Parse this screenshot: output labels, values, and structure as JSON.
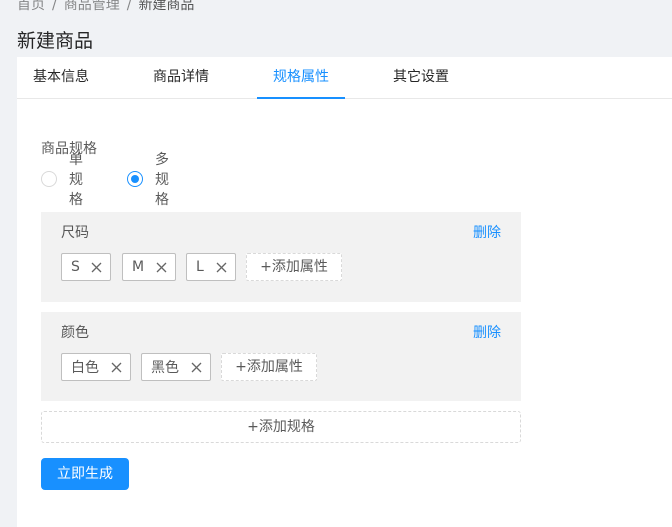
{
  "breadcrumb": {
    "items": [
      "首页",
      "商品管理",
      "新建商品"
    ],
    "separator": "/"
  },
  "page": {
    "title": "新建商品"
  },
  "tabs": [
    {
      "label": "基本信息",
      "active": false
    },
    {
      "label": "商品详情",
      "active": false
    },
    {
      "label": "规格属性",
      "active": true
    },
    {
      "label": "其它设置",
      "active": false
    }
  ],
  "spec_type": {
    "label": "商品规格",
    "options": [
      {
        "label": "单规格",
        "checked": false
      },
      {
        "label": "多规格",
        "checked": true
      }
    ]
  },
  "specs": [
    {
      "name": "尺码",
      "delete_label": "删除",
      "values": [
        "S",
        "M",
        "L"
      ],
      "add_value_label": "+添加属性"
    },
    {
      "name": "颜色",
      "delete_label": "删除",
      "values": [
        "白色",
        "黑色"
      ],
      "add_value_label": "+添加属性"
    }
  ],
  "add_spec_label": "+添加规格",
  "generate_button": {
    "label": "立即生成"
  },
  "colors": {
    "primary": "#1890ff",
    "background": "#f0f2f5",
    "panel": "#f2f2f2"
  }
}
